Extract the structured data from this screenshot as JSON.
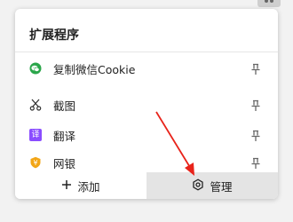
{
  "panel": {
    "title": "扩展程序"
  },
  "extensions": [
    {
      "label": "复制微信Cookie",
      "icon": "wechat-icon",
      "icon_color": "#2aa64a"
    },
    {
      "label": "截图",
      "icon": "scissors-icon",
      "icon_color": "#333333"
    },
    {
      "label": "翻译",
      "icon": "translate-icon",
      "icon_color": "#8a4dff",
      "icon_text": "译"
    },
    {
      "label": "网银",
      "icon": "bank-shield-icon",
      "icon_color": "#f2a516",
      "icon_text": "¥"
    }
  ],
  "footer": {
    "add_label": "添加",
    "manage_label": "管理"
  },
  "colors": {
    "annotation_arrow": "#e8231a"
  }
}
